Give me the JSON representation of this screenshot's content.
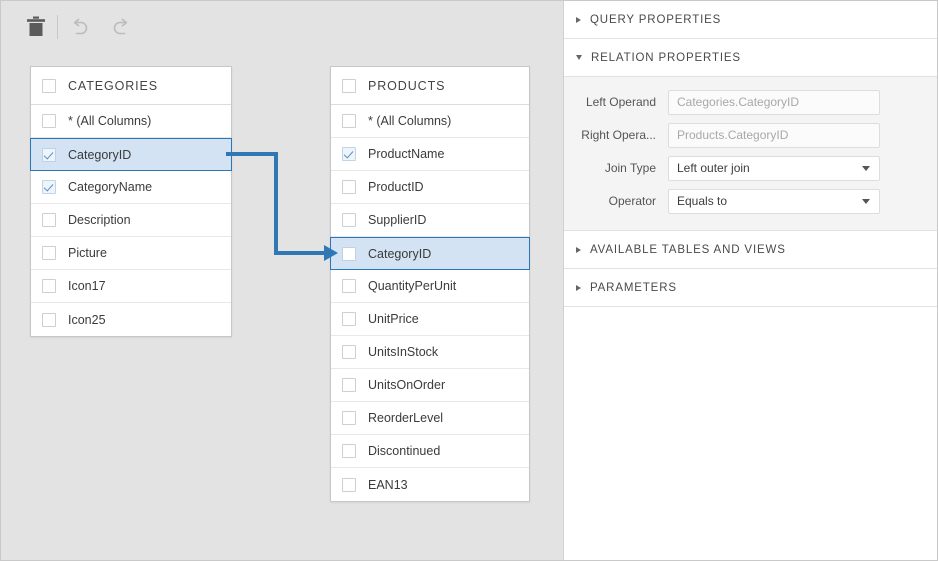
{
  "toolbar": {
    "delete_label": "Delete",
    "undo_label": "Undo",
    "redo_label": "Redo"
  },
  "canvas": {
    "tables": [
      {
        "name": "CATEGORIES",
        "header_checked": false,
        "columns": [
          {
            "label": "* (All Columns)",
            "checked": false,
            "selected": false
          },
          {
            "label": "CategoryID",
            "checked": true,
            "selected": true
          },
          {
            "label": "CategoryName",
            "checked": true,
            "selected": false
          },
          {
            "label": "Description",
            "checked": false,
            "selected": false
          },
          {
            "label": "Picture",
            "checked": false,
            "selected": false
          },
          {
            "label": "Icon17",
            "checked": false,
            "selected": false
          },
          {
            "label": "Icon25",
            "checked": false,
            "selected": false
          }
        ]
      },
      {
        "name": "PRODUCTS",
        "header_checked": false,
        "columns": [
          {
            "label": "* (All Columns)",
            "checked": false,
            "selected": false
          },
          {
            "label": "ProductName",
            "checked": true,
            "selected": false
          },
          {
            "label": "ProductID",
            "checked": false,
            "selected": false
          },
          {
            "label": "SupplierID",
            "checked": false,
            "selected": false
          },
          {
            "label": "CategoryID",
            "checked": false,
            "selected": true
          },
          {
            "label": "QuantityPerUnit",
            "checked": false,
            "selected": false
          },
          {
            "label": "UnitPrice",
            "checked": false,
            "selected": false
          },
          {
            "label": "UnitsInStock",
            "checked": false,
            "selected": false
          },
          {
            "label": "UnitsOnOrder",
            "checked": false,
            "selected": false
          },
          {
            "label": "ReorderLevel",
            "checked": false,
            "selected": false
          },
          {
            "label": "Discontinued",
            "checked": false,
            "selected": false
          },
          {
            "label": "EAN13",
            "checked": false,
            "selected": false
          }
        ]
      }
    ],
    "relation_link_color": "#2f77b5"
  },
  "panel": {
    "sections": [
      {
        "title": "QUERY PROPERTIES",
        "expanded": false
      },
      {
        "title": "RELATION PROPERTIES",
        "expanded": true
      },
      {
        "title": "AVAILABLE TABLES AND VIEWS",
        "expanded": false
      },
      {
        "title": "PARAMETERS",
        "expanded": false
      }
    ],
    "relation_properties": {
      "fields": [
        {
          "label": "Left Operand",
          "value": "Categories.CategoryID",
          "type": "readonly"
        },
        {
          "label": "Right Opera...",
          "value": "Products.CategoryID",
          "type": "readonly"
        },
        {
          "label": "Join Type",
          "value": "Left outer join",
          "type": "select"
        },
        {
          "label": "Operator",
          "value": "Equals to",
          "type": "select"
        }
      ]
    }
  },
  "colors": {
    "accent": "#2f77b5",
    "selection_bg": "#d3e3f3",
    "canvas_bg": "#e3e3e3"
  }
}
